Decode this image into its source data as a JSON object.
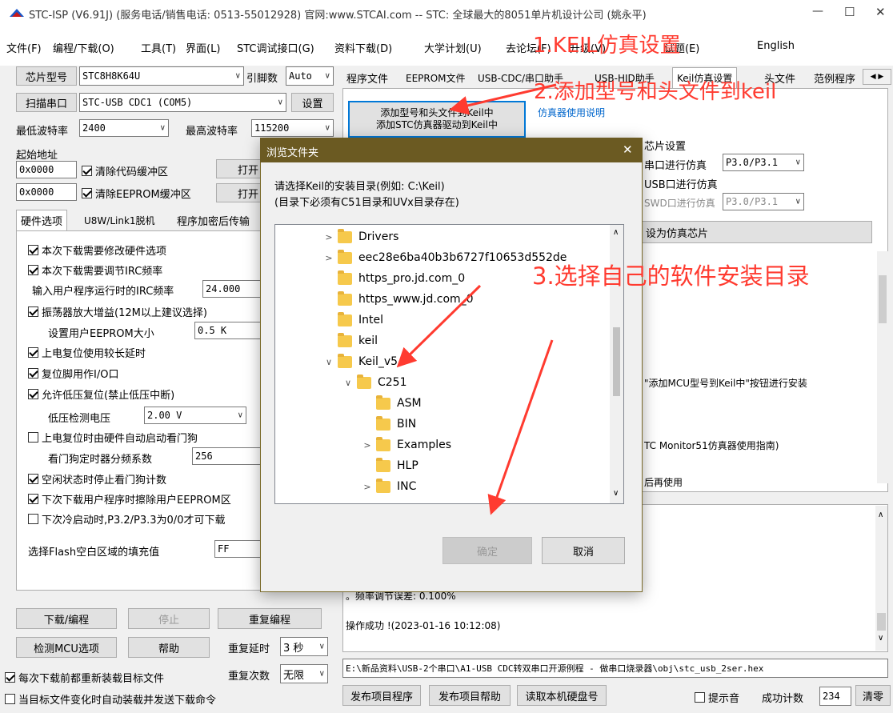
{
  "window": {
    "title": "STC-ISP (V6.91J) (服务电话/销售电话: 0513-55012928) 官网:www.STCAI.com  -- STC: 全球最大的8051单片机设计公司 (姚永平)",
    "min": "—",
    "max": "☐",
    "close": "✕"
  },
  "menu": [
    "文件(F)",
    "编程/下载(O)",
    "工具(T)",
    "界面(L)",
    "STC调试接口(G)",
    "资料下载(D)",
    "大学计划(U)",
    "去论坛(F)",
    "升级(V)",
    "试题(E)",
    "English"
  ],
  "left": {
    "chip_btn": "芯片型号",
    "chip_val": "STC8H8K64U",
    "pins_lbl": "引脚数",
    "pins_val": "Auto",
    "scan_btn": "扫描串口",
    "port_val": "STC-USB CDC1 (COM5)",
    "settings_btn": "设置",
    "minbaud_lbl": "最低波特率",
    "minbaud_val": "2400",
    "maxbaud_lbl": "最高波特率",
    "maxbaud_val": "115200",
    "start_addr_lbl": "起始地址",
    "addr1": "0x0000",
    "clear_code": "清除代码缓冲区",
    "open1": "打开",
    "addr2": "0x0000",
    "clear_eeprom": "清除EEPROM缓冲区",
    "open2": "打开",
    "tabs": [
      "硬件选项",
      "U8W/Link1脱机",
      "程序加密后传输"
    ],
    "opts": {
      "o1": "本次下载需要修改硬件选项",
      "o2": "本次下载需要调节IRC频率",
      "irc_lbl": "输入用户程序运行时的IRC频率",
      "irc_val": "24.000",
      "o3": "振荡器放大增益(12M以上建议选择)",
      "eeprom_lbl": "设置用户EEPROM大小",
      "eeprom_val": "0.5 K",
      "o4": "上电复位使用较长延时",
      "o5": "复位脚用作I/O口",
      "o6": "允许低压复位(禁止低压中断)",
      "lv_lbl": "低压检测电压",
      "lv_val": "2.00 V",
      "o7": "上电复位时由硬件自动启动看门狗",
      "wdt_lbl": "看门狗定时器分频系数",
      "wdt_val": "256",
      "o8": "空闲状态时停止看门狗计数",
      "o9": "下次下载用户程序时擦除用户EEPROM区",
      "o10": "下次冷启动时,P3.2/P3.3为0/0才可下载",
      "fill_lbl": "选择Flash空白区域的填充值",
      "fill_val": "FF"
    },
    "download_btn": "下载/编程",
    "stop_btn": "停止",
    "repeat_btn": "重复编程",
    "detect_btn": "检测MCU选项",
    "help_btn": "帮助",
    "delay_lbl": "重复延时",
    "delay_val": "3 秒",
    "count_lbl": "重复次数",
    "count_val": "无限",
    "reload_chk": "每次下载前都重新装载目标文件",
    "auto_chk": "当目标文件变化时自动装载并发送下载命令"
  },
  "right": {
    "tabs": [
      "程序文件",
      "EEPROM文件",
      "USB-CDC/串口助手",
      "USB-HID助手",
      "Keil仿真设置",
      "头文件",
      "范例程序"
    ],
    "add_btn": "添加型号和头文件到Keil中\n添加STC仿真器驱动到Keil中",
    "manual_link": "仿真器使用说明",
    "chip_settings": "芯片设置",
    "serial_sim": "串口进行仿真",
    "serial_val": "P3.0/P3.1",
    "usb_sim": "USB口进行仿真",
    "swd_sim": "SWD口进行仿真",
    "swd_val": "P3.0/P3.1",
    "set_chip": "设为仿真芯片",
    "info1": "\"添加MCU型号到Keil中\"按钮进行安装",
    "info2": "TC Monitor51仿真器使用指南)",
    "info3": "后再使用",
    "log1": "。频率调节误差: 0.100%",
    "log2": "操作成功 !(2023-01-16 10:12:08)",
    "path": "E:\\新品资料\\USB-2个串口\\A1-USB CDC转双串口开源例程 - 做串口烧录器\\obj\\stc_usb_2ser.hex"
  },
  "bottom": {
    "publish_btn": "发布项目程序",
    "publish_help_btn": "发布项目帮助",
    "read_disk_btn": "读取本机硬盘号",
    "beep": "提示音",
    "success_lbl": "成功计数",
    "success_val": "234",
    "clear_btn": "清零"
  },
  "dialog": {
    "title": "浏览文件夹",
    "close": "✕",
    "prompt1": "请选择Keil的安装目录(例如: C:\\Keil)",
    "prompt2": "(目录下必须有C51目录和UVx目录存在)",
    "tree": [
      "Drivers",
      "eec28e6ba40b3b6727f10653d552de",
      "https_pro.jd.com_0",
      "https_www.jd.com_0",
      "Intel",
      "keil",
      "Keil_v5",
      "C251",
      "ASM",
      "BIN",
      "Examples",
      "HLP",
      "INC"
    ],
    "ok": "确定",
    "cancel": "取消"
  },
  "annotations": {
    "a1": "1.KEIL仿真设置",
    "a2": "2.添加型号和头文件到keil",
    "a3": "3.选择自己的软件安装目录",
    "color": "#ff3b30"
  }
}
